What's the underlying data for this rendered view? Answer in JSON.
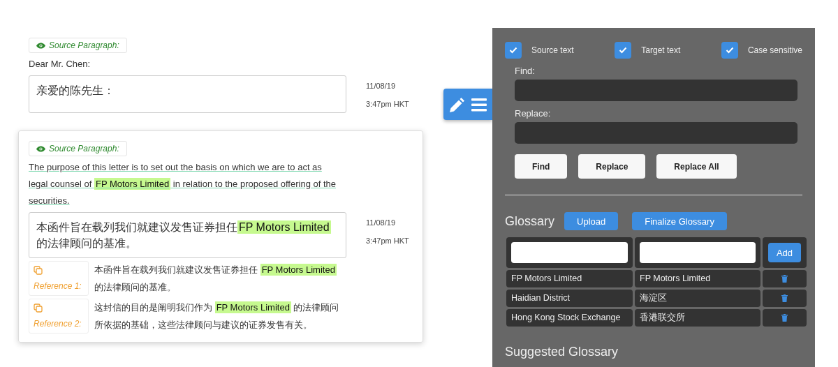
{
  "segments": [
    {
      "label": "Source Paragraph:",
      "selected": false,
      "source": [
        {
          "text": "Dear Mr. Chen:",
          "highlight": false
        }
      ],
      "target": [
        {
          "text": "亲爱的陈先生：",
          "highlight": false
        }
      ],
      "date": "11/08/19",
      "time": "3:47pm HKT"
    },
    {
      "label": "Source Paragraph:",
      "selected": true,
      "source": [
        {
          "text": "The purpose of this letter is to set out the basis on which we are to act as legal counsel of ",
          "highlight": false
        },
        {
          "text": "FP Motors Limited",
          "highlight": true
        },
        {
          "text": " in relation to the proposed offering of the securities.",
          "highlight": false
        }
      ],
      "target": [
        {
          "text": "本函件旨在载列我们就建议发售证券担任",
          "highlight": false
        },
        {
          "text": "FP Motors Limited",
          "highlight": true
        },
        {
          "text": "的法律顾问的基准。",
          "highlight": false
        }
      ],
      "date": "11/08/19",
      "time": "3:47pm HKT",
      "references": [
        {
          "label": "Reference 1:",
          "parts": [
            {
              "text": "本函件旨在载列我们就建议发售证券担任 ",
              "highlight": false
            },
            {
              "text": "FP Motors Limited",
              "highlight": true
            },
            {
              "text": " 的法律顾问的基准。",
              "highlight": false
            }
          ]
        },
        {
          "label": "Reference 2:",
          "parts": [
            {
              "text": "这封信的目的是阐明我们作为 ",
              "highlight": false
            },
            {
              "text": "FP Motors Limited",
              "highlight": true
            },
            {
              "text": " 的法律顾问所依据的基础，这些法律顾问与建议的证券发售有关。",
              "highlight": false
            }
          ]
        }
      ]
    }
  ],
  "panel": {
    "options": [
      {
        "label": "Source text",
        "checked": true
      },
      {
        "label": "Target text",
        "checked": true
      },
      {
        "label": "Case sensitive",
        "checked": true
      }
    ],
    "find_label": "Find:",
    "replace_label": "Replace:",
    "buttons": [
      "Find",
      "Replace",
      "Replace All"
    ],
    "glossary": {
      "title": "Glossary",
      "upload": "Upload",
      "finalize": "Finalize Glossary",
      "add": "Add",
      "rows": [
        {
          "source": "FP Motors Limited",
          "target": "FP Motors Limited"
        },
        {
          "source": "Haidian District",
          "target": "海淀区"
        },
        {
          "source": "Hong Kong Stock Exchange",
          "target": "香港联交所"
        }
      ]
    },
    "suggested_title": "Suggested Glossary"
  }
}
